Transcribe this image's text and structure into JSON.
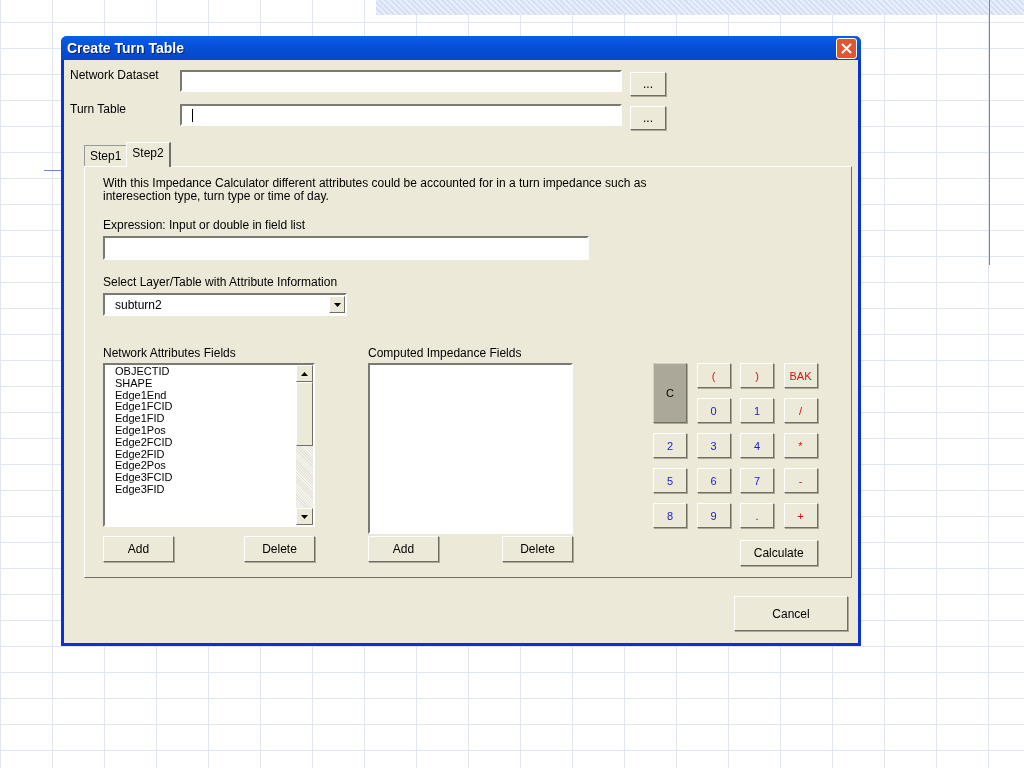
{
  "window": {
    "title": "Create Turn Table"
  },
  "fields": [
    {
      "label": "Network Dataset",
      "focused": false,
      "browse": "..."
    },
    {
      "label": "Turn Table",
      "focused": true,
      "browse": "..."
    }
  ],
  "tabs": [
    {
      "label": "Step1",
      "selected": false
    },
    {
      "label": "Step2",
      "selected": true
    }
  ],
  "description": "With this Impedance Calculator different attributes could be accounted for in a turn impedance such as interesection type, turn type or time of day.",
  "expression": {
    "label": "Expression: Input or double in field list"
  },
  "layer_select": {
    "label": "Select Layer/Table with Attribute Information",
    "value": "subturn2"
  },
  "attribute_list": {
    "label": "Network Attributes Fields",
    "items": [
      "OBJECTID",
      "SHAPE",
      "Edge1End",
      "Edge1FCID",
      "Edge1FID",
      "Edge1Pos",
      "Edge2FCID",
      "Edge2FID",
      "Edge2Pos",
      "Edge3FCID",
      "Edge3FID"
    ],
    "buttons": [
      "Add",
      "Delete"
    ]
  },
  "computed_list": {
    "label": "Computed Impedance Fields",
    "buttons": [
      "Add",
      "Delete"
    ]
  },
  "clear_button": "C",
  "keypad": [
    {
      "label": "(",
      "kind": "operator"
    },
    {
      "label": ")",
      "kind": "operator"
    },
    {
      "label": "BAK",
      "kind": "operator"
    },
    {
      "label": "0",
      "kind": "digit"
    },
    {
      "label": "1",
      "kind": "digit"
    },
    {
      "label": "/",
      "kind": "operator"
    },
    {
      "label": "2",
      "kind": "digit"
    },
    {
      "label": "3",
      "kind": "digit"
    },
    {
      "label": "4",
      "kind": "digit"
    },
    {
      "label": "*",
      "kind": "operator"
    },
    {
      "label": "5",
      "kind": "digit"
    },
    {
      "label": "6",
      "kind": "digit"
    },
    {
      "label": "7",
      "kind": "digit"
    },
    {
      "label": "-",
      "kind": "operator"
    },
    {
      "label": "8",
      "kind": "digit"
    },
    {
      "label": "9",
      "kind": "digit"
    },
    {
      "label": ".",
      "kind": "digit"
    },
    {
      "label": "+",
      "kind": "operator"
    }
  ],
  "calculate_button": "Calculate",
  "cancel_button": "Cancel"
}
